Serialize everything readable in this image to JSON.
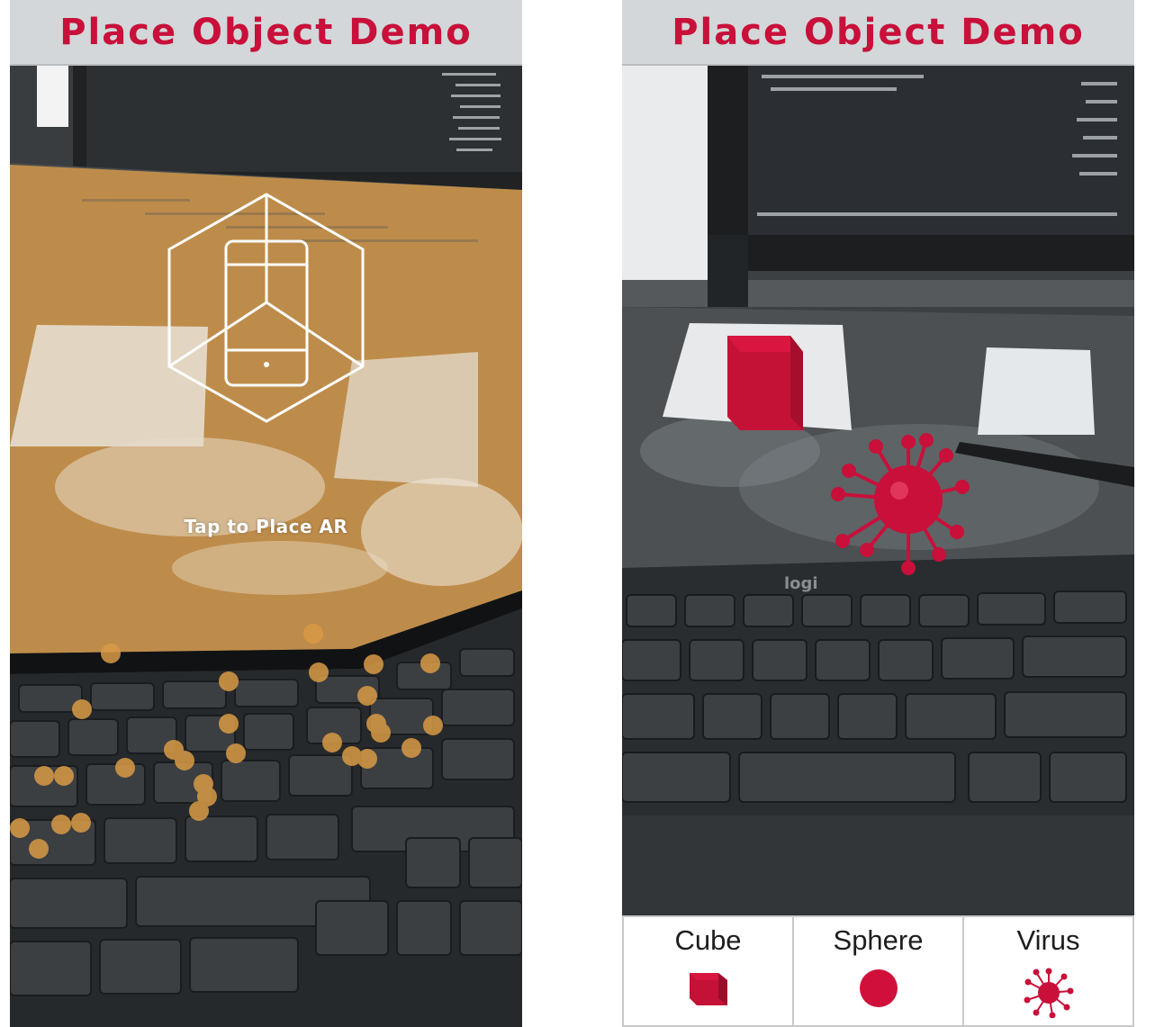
{
  "left_screen": {
    "title": "Place Object Demo",
    "hint": "Tap to Place AR",
    "icons": {
      "onboarding": "phone-in-hexagon-icon"
    }
  },
  "right_screen": {
    "title": "Place Object Demo",
    "menu": [
      {
        "label": "Cube",
        "icon": "cube-icon"
      },
      {
        "label": "Sphere",
        "icon": "sphere-icon"
      },
      {
        "label": "Virus",
        "icon": "virus-icon"
      }
    ],
    "keyboard_brand": "logi"
  },
  "colors": {
    "title_text": "#c8103a",
    "title_bar": "#d3d7d9",
    "accent_red": "#d0103a",
    "plane_overlay": "#c8914a"
  }
}
